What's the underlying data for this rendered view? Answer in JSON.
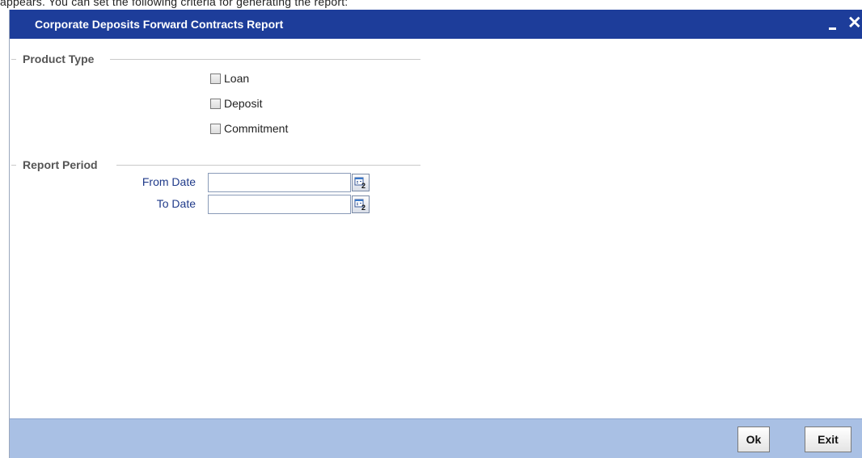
{
  "caption_fragment": "appears. You can set the following criteria for generating the report:",
  "window": {
    "title": "Corporate Deposits Forward Contracts Report",
    "minimize_icon": "minimize-icon",
    "close_icon": "close-icon",
    "close_glyph": "✕"
  },
  "product_type": {
    "legend": "Product Type",
    "options": [
      {
        "label": "Loan",
        "checked": false
      },
      {
        "label": "Deposit",
        "checked": false
      },
      {
        "label": "Commitment",
        "checked": false
      }
    ]
  },
  "report_period": {
    "legend": "Report Period",
    "from_date": {
      "label": "From Date",
      "value": "",
      "placeholder": ""
    },
    "to_date": {
      "label": "To Date",
      "value": "",
      "placeholder": ""
    },
    "calendar_icon": "calendar-icon"
  },
  "footer": {
    "ok_label": "Ok",
    "exit_label": "Exit"
  },
  "colors": {
    "titlebar": "#1d3d9a",
    "footer": "#a9c0e4",
    "field_label": "#1f3a8a",
    "legend": "#555555"
  }
}
